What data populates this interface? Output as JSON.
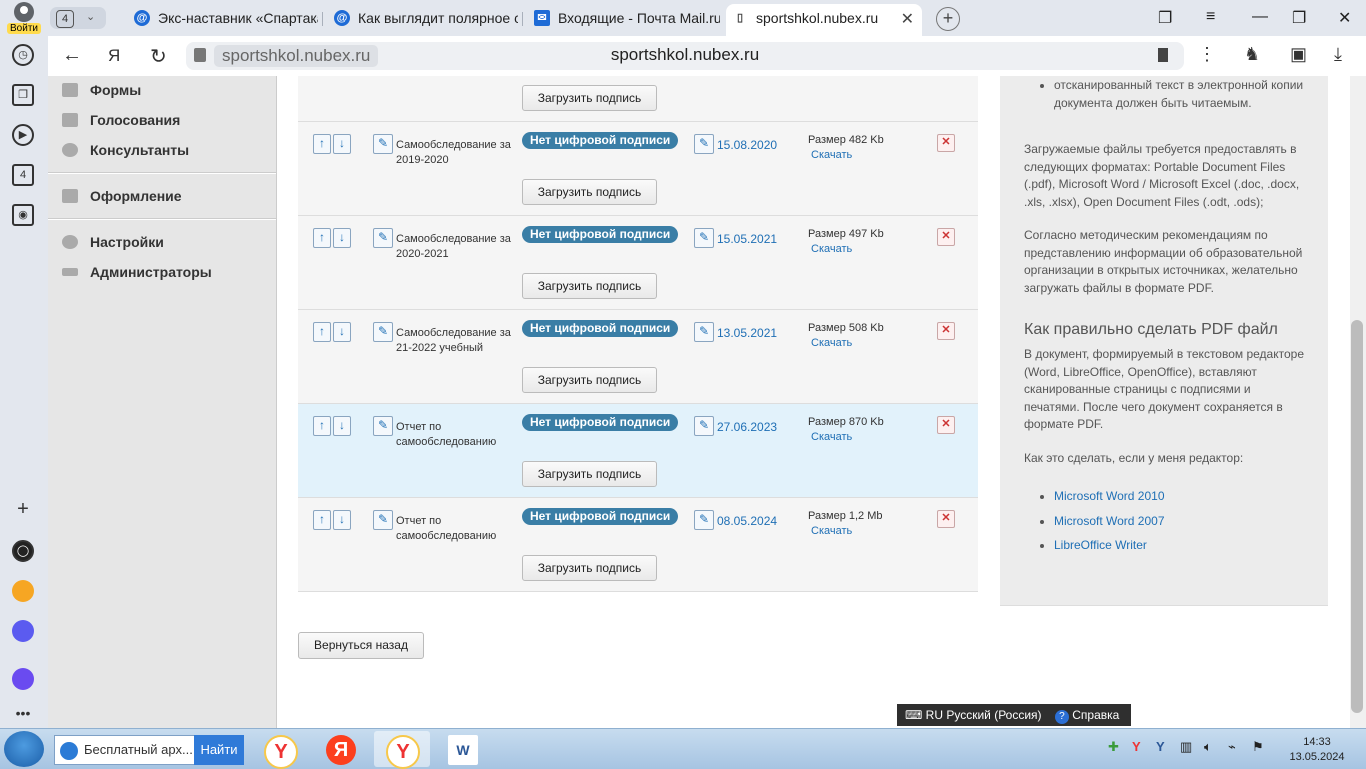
{
  "browser": {
    "profile_label": "Войти",
    "tab_count": "4",
    "tabs": [
      {
        "title": "Экс-наставник «Спартака",
        "icon": "at"
      },
      {
        "title": "Как выглядит полярное си",
        "icon": "at"
      },
      {
        "title": "Входящие - Почта Mail.ru",
        "icon": "mail"
      },
      {
        "title": "sportshkol.nubex.ru",
        "icon": "page"
      }
    ],
    "close_tab": "✕",
    "new_tab": "+",
    "omnibox_host": "sportshkol.nubex.ru",
    "omnibox_center": "sportshkol.nubex.ru",
    "sidebar_badge": "4"
  },
  "admin_menu": [
    {
      "label": "Формы"
    },
    {
      "label": "Голосования"
    },
    {
      "label": "Консультанты"
    },
    {
      "label": "Оформление"
    },
    {
      "label": "Настройки"
    },
    {
      "label": "Администраторы"
    }
  ],
  "documents": {
    "sign_button": "Загрузить подпись",
    "no_signature": "Нет цифровой подписи",
    "download": "Скачать",
    "rows": [
      {
        "name": "Самообследование за 2019-2020",
        "date": "15.08.2020",
        "size": "Размер 482 Kb"
      },
      {
        "name": "Самообследование за 2020-2021",
        "date": "15.05.2021",
        "size": "Размер 497 Kb"
      },
      {
        "name": "Самообследование за 21-2022 учебный",
        "date": "13.05.2021",
        "size": "Размер 508 Kb"
      },
      {
        "name": "Отчет по самообследованию",
        "date": "27.06.2023",
        "size": "Размер 870 Kb",
        "highlighted": true
      },
      {
        "name": "Отчет по самообследованию",
        "date": "08.05.2024",
        "size": "Размер 1,2 Mb"
      }
    ]
  },
  "back_button": "Вернуться назад",
  "help": {
    "bullet_top": "отсканированный текст в электронной копии документа должен быть читаемым.",
    "formats_text": "Загружаемые файлы требуется предоставлять в следующих форматах: Portable Document Files (.pdf), Microsoft Word / Microsoft Excel (.doc, .docx, .xls, .xlsx), Open Document Files (.odt, .ods);",
    "recommend_text": "Согласно методическим рекомендациям по представлению информации об образовательной организации в открытых источниках, желательно загружать файлы в формате PDF.",
    "pdf_heading": "Как правильно сделать PDF файл",
    "pdf_text": "В документ, формируемый в текстовом редакторе (Word, LibreOffice, OpenOffice), вставляют сканированные страницы с подписями и печатями. После чего документ сохраняется в формате PDF.",
    "how_text": "Как это сделать, если у меня редактор:",
    "links": [
      "Microsoft Word 2010",
      "Microsoft Word 2007",
      "LibreOffice Writer"
    ]
  },
  "langbar": {
    "lang": "RU Русский (Россия)",
    "help": "Справка"
  },
  "taskbar": {
    "search_text": "Бесплатный арх...",
    "find_button": "Найти",
    "time": "14:33",
    "date": "13.05.2024"
  }
}
